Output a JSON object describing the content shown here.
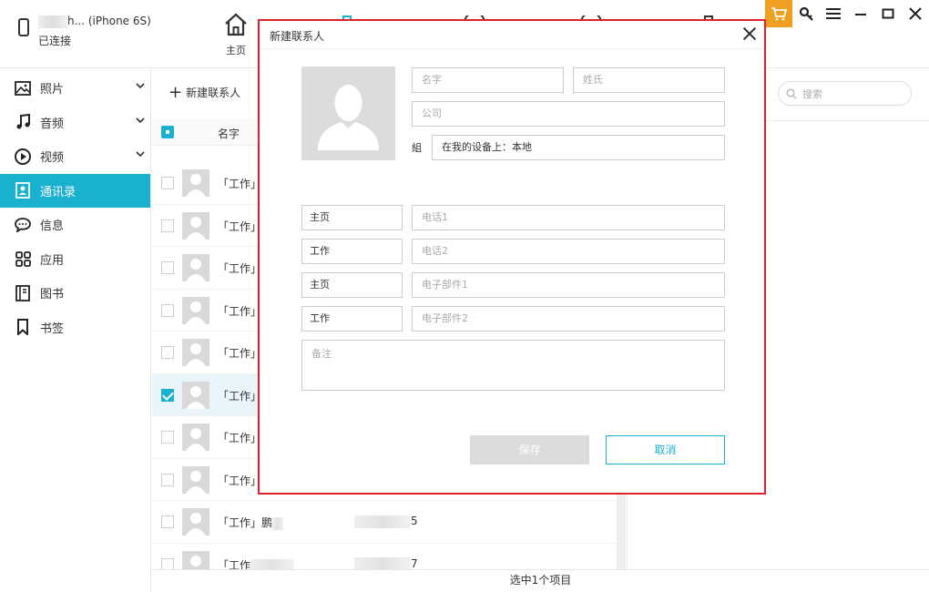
{
  "device": {
    "name_suffix": "h... (iPhone 6S)",
    "status": "已连接"
  },
  "nav": {
    "home_label": "主页"
  },
  "colors": {
    "accent": "#1ab0cf",
    "cart": "#f0a020",
    "dialog_border": "#e0202a"
  },
  "sidebar": {
    "items": [
      {
        "label": "照片",
        "icon": "photo-icon",
        "expandable": true
      },
      {
        "label": "音频",
        "icon": "music-icon",
        "expandable": true
      },
      {
        "label": "视频",
        "icon": "video-icon",
        "expandable": true
      },
      {
        "label": "通讯录",
        "icon": "contacts-icon",
        "active": true
      },
      {
        "label": "信息",
        "icon": "message-icon"
      },
      {
        "label": "应用",
        "icon": "apps-icon"
      },
      {
        "label": "图书",
        "icon": "book-icon"
      },
      {
        "label": "书签",
        "icon": "bookmark-icon"
      }
    ]
  },
  "list": {
    "new_contact_label": "新建联系人",
    "header_name": "名字",
    "rows": [
      {
        "name": "「工作」刘",
        "selected": false
      },
      {
        "name": "「工作」刘",
        "selected": false
      },
      {
        "name": "「工作」刘",
        "selected": false
      },
      {
        "name": "「工作」马",
        "selected": false
      },
      {
        "name": "「工作」尤",
        "selected": false
      },
      {
        "name": "「工作」郭",
        "selected": true
      },
      {
        "name": "「工作」周",
        "selected": false
      },
      {
        "name": "「工作」潘",
        "selected": false
      },
      {
        "name": "「工作」鹏",
        "selected": false,
        "phone": "5"
      },
      {
        "name": "「工作",
        "selected": false,
        "phone": "7"
      }
    ]
  },
  "search": {
    "placeholder": "搜索"
  },
  "statusbar": {
    "text": "选中1个项目"
  },
  "dialog": {
    "title": "新建联系人",
    "first_name_placeholder": "名字",
    "last_name_placeholder": "姓氏",
    "company_placeholder": "公司",
    "group_label": "組",
    "group_value": "在我的设备上：本地",
    "phone1_type": "主页",
    "phone1_placeholder": "电话1",
    "phone2_type": "工作",
    "phone2_placeholder": "电话2",
    "email1_type": "主页",
    "email1_placeholder": "电子部件1",
    "email2_type": "工作",
    "email2_placeholder": "电子部件2",
    "notes_placeholder": "备注",
    "save_label": "保存",
    "cancel_label": "取消"
  }
}
